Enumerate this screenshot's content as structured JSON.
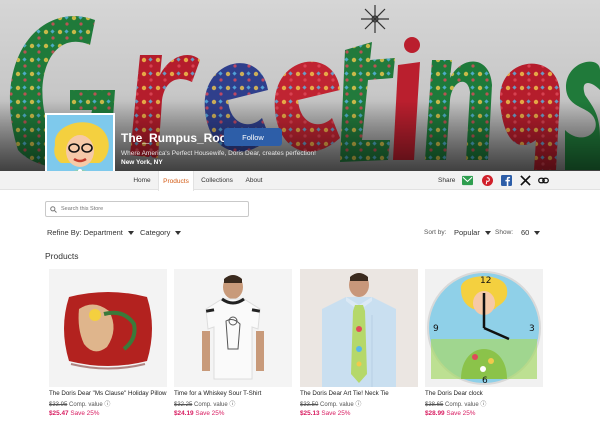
{
  "banner": {
    "word": "Greetings"
  },
  "store": {
    "name": "The_Rumpus_Room",
    "follow_label": "Follow",
    "tagline": "Where America's Perfect Housewife, Doris Dear, creates perfection!",
    "location": "New York, NY"
  },
  "nav": {
    "tabs": [
      {
        "label": "Home"
      },
      {
        "label": "Products",
        "active": true
      },
      {
        "label": "Collections"
      },
      {
        "label": "About"
      }
    ],
    "share_label": "Share",
    "share_icons": [
      "email-icon",
      "pinterest-icon",
      "facebook-icon",
      "x-icon",
      "link-icon"
    ]
  },
  "search": {
    "placeholder": "Search this Store",
    "value": ""
  },
  "filters": {
    "refine_label": "Refine By: Department",
    "category_label": "Category",
    "sort_by_label": "Sort by:",
    "sort_value": "Popular",
    "show_label": "Show:",
    "show_value": "60"
  },
  "products_title": "Products",
  "products": [
    {
      "title": "The Doris Dear \"Ms Clause\" Holiday Pillow",
      "comp_price": "$33.95",
      "comp_label": "Comp. value",
      "price": "$25.47",
      "save": "Save 25%"
    },
    {
      "title": "Time for a Whiskey Sour T-Shirt",
      "comp_price": "$32.25",
      "comp_label": "Comp. value",
      "price": "$24.19",
      "save": "Save 25%"
    },
    {
      "title": "The Doris Dear Art Tie! Neck Tie",
      "comp_price": "$33.50",
      "comp_label": "Comp. value",
      "price": "$25.13",
      "save": "Save 25%"
    },
    {
      "title": "The Doris Dear clock",
      "comp_price": "$38.65",
      "comp_label": "Comp. value",
      "price": "$28.99",
      "save": "Save 25%"
    }
  ],
  "colors": {
    "accent_orange": "#d35a13",
    "follow_blue": "#2d5ea8",
    "sale_pink": "#d81b60"
  }
}
